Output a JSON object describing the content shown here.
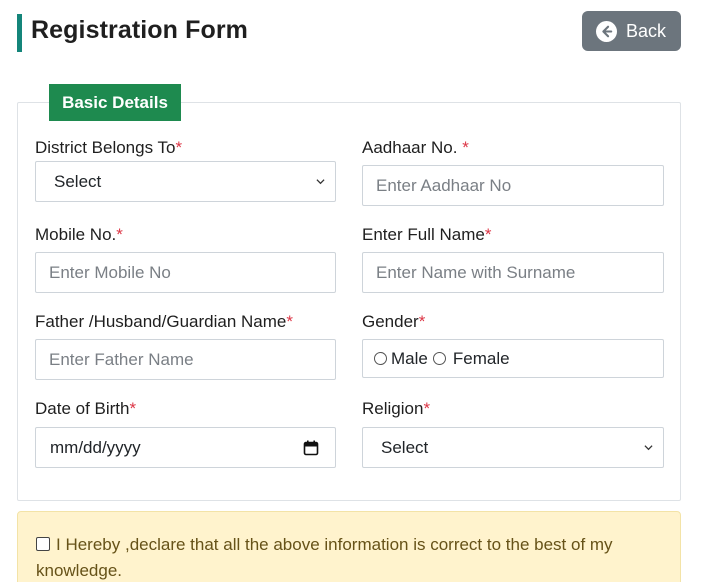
{
  "header": {
    "title": "Registration Form",
    "back_label": "Back"
  },
  "section": {
    "legend": "Basic Details"
  },
  "fields": {
    "district": {
      "label": "District Belongs To",
      "required_mark": "*",
      "value": "Select"
    },
    "aadhaar": {
      "label": "Aadhaar No. ",
      "required_mark": "*",
      "placeholder": "Enter Aadhaar No"
    },
    "mobile": {
      "label": "Mobile No.",
      "required_mark": "*",
      "placeholder": "Enter Mobile No"
    },
    "full_name": {
      "label": "Enter Full Name",
      "required_mark": "*",
      "placeholder": "Enter Name with Surname"
    },
    "father_name": {
      "label": "Father /Husband/Guardian Name",
      "required_mark": "*",
      "placeholder": "Enter Father Name"
    },
    "gender": {
      "label": "Gender",
      "required_mark": "*",
      "options": [
        "Male",
        "Female"
      ]
    },
    "dob": {
      "label": "Date of Birth",
      "required_mark": "*",
      "placeholder": "mm/dd/yyyy"
    },
    "religion": {
      "label": "Religion",
      "required_mark": "*",
      "value": "Select"
    }
  },
  "declaration": {
    "text": "I Hereby ,declare that all the above information is correct to the best of my knowledge."
  },
  "icons": {
    "back": "arrow-left-circle-icon",
    "select": "chevron-down-icon",
    "date": "calendar-icon"
  },
  "colors": {
    "accent": "#14857a",
    "legend_bg": "#1e8a4f",
    "required": "#dc3545",
    "back_btn": "#6c757d",
    "alert_bg": "#fff3cd"
  }
}
